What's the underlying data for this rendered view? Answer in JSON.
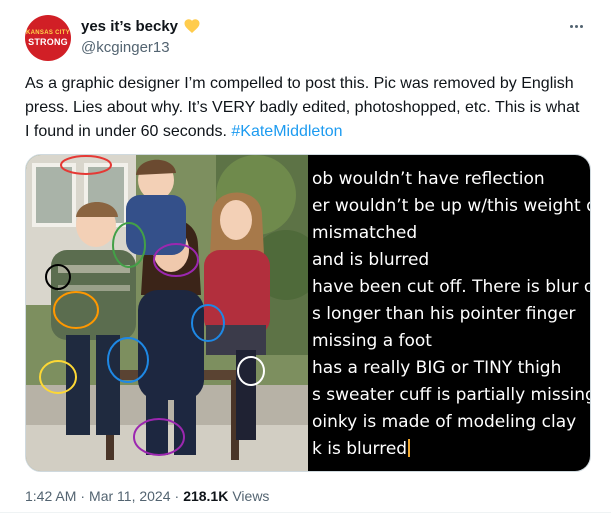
{
  "author": {
    "display_name": "yes it’s becky",
    "handle": "@kcginger13",
    "avatar_text_small": "KANSAS CITY",
    "avatar_text_big": "STRONG"
  },
  "tweet": {
    "text_before_hashtag": "As a graphic designer I’m compelled to post this. Pic was removed by English press. Lies about why. It’s VERY badly edited, photoshopped, etc. This is what I found in under 60 seconds. ",
    "hashtag": "#KateMiddleton"
  },
  "media": {
    "annotation_lines": [
      "ob wouldn’t have reflection",
      "er wouldn’t be up w/this weight di",
      "mismatched",
      "and is blurred",
      " have been cut off. There is blur o",
      "s longer than his pointer finger",
      "missing a foot",
      "has a really BIG or TINY thigh",
      "s sweater cuff is partially missing",
      "oinky is made of modeling clay",
      "k is blurred"
    ],
    "circle_colors": [
      "#e53935",
      "#43a047",
      "#9c27b0",
      "#1e88e5",
      "#fdd835",
      "#ff9800",
      "#ffffff",
      "#000000"
    ]
  },
  "footer": {
    "time": "1:42 AM",
    "sep1": "·",
    "date": "Mar 11, 2024",
    "sep2": "·",
    "views_count": "218.1K",
    "views_label": "Views"
  }
}
